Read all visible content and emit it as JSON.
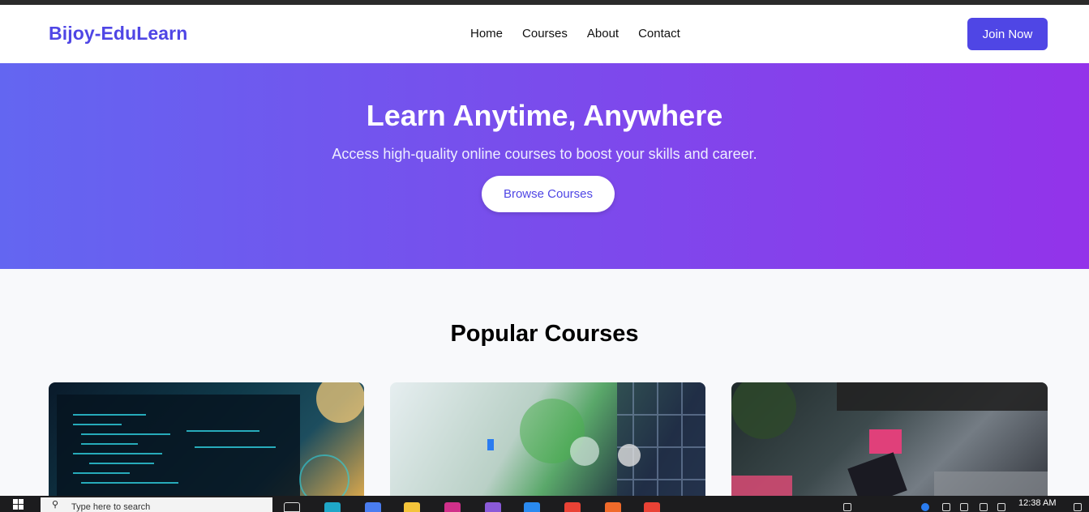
{
  "navbar": {
    "brand": "Bijoy-EduLearn",
    "links": [
      "Home",
      "Courses",
      "About",
      "Contact"
    ],
    "cta": "Join Now"
  },
  "hero": {
    "title": "Learn Anytime, Anywhere",
    "subtitle": "Access high-quality online courses to boost your skills and career.",
    "button": "Browse Courses"
  },
  "courses": {
    "title": "Popular Courses"
  },
  "taskbar": {
    "search_placeholder": "Type here to search",
    "time": "12:38 AM"
  }
}
